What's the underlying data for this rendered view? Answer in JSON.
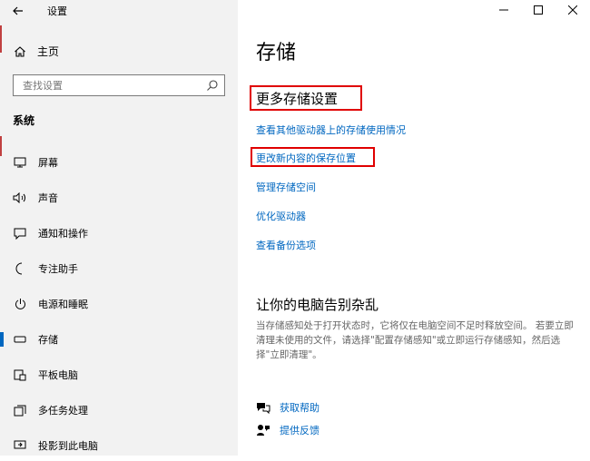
{
  "window": {
    "app_title": "设置",
    "controls": {
      "minimize": "—",
      "maximize": "☐",
      "close": "✕"
    }
  },
  "sidebar": {
    "home_label": "主页",
    "search_placeholder": "查找设置",
    "section_label": "系统",
    "items": [
      {
        "label": "屏幕",
        "icon": "monitor-icon"
      },
      {
        "label": "声音",
        "icon": "speaker-icon"
      },
      {
        "label": "通知和操作",
        "icon": "notification-icon"
      },
      {
        "label": "专注助手",
        "icon": "moon-icon"
      },
      {
        "label": "电源和睡眠",
        "icon": "power-icon"
      },
      {
        "label": "存储",
        "icon": "storage-icon",
        "selected": true
      },
      {
        "label": "平板电脑",
        "icon": "tablet-icon"
      },
      {
        "label": "多任务处理",
        "icon": "multitask-icon"
      },
      {
        "label": "投影到此电脑",
        "icon": "project-icon"
      }
    ]
  },
  "main": {
    "title": "存储",
    "more_settings": {
      "heading": "更多存储设置",
      "links": [
        "查看其他驱动器上的存储使用情况",
        "更改新内容的保存位置",
        "管理存储空间",
        "优化驱动器",
        "查看备份选项"
      ]
    },
    "declutter": {
      "heading": "让你的电脑告别杂乱",
      "description": "当存储感知处于打开状态时，它将仅在电脑空间不足时释放空间。 若要立即清理未使用的文件，请选择\"配置存储感知\"或立即运行存储感知，然后选择\"立即清理\"。"
    },
    "help": {
      "get_help": "获取帮助",
      "feedback": "提供反馈"
    }
  },
  "colors": {
    "accent": "#0067c0",
    "highlight": "#e00000",
    "sidebar_bg": "#f2f2f2"
  }
}
